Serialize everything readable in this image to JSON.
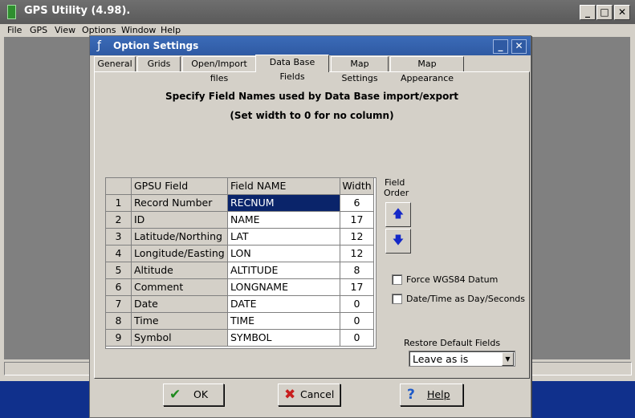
{
  "app": {
    "title": "GPS Utility (4.98).",
    "menu": [
      "File",
      "GPS",
      "View",
      "Options",
      "Window",
      "Help"
    ],
    "controls": {
      "minimize": "_",
      "maximize": "□",
      "close": "✕"
    }
  },
  "dialog": {
    "title": "Option Settings",
    "controls": {
      "minimize": "_",
      "close": "✕"
    },
    "tabs": [
      "General",
      "Grids",
      "Open/Import files",
      "Data Base Fields",
      "Map Settings",
      "Map Appearance"
    ],
    "active_tab": "Data Base Fields",
    "heading": "Specify Field Names used by Data Base import/export",
    "subheading": "(Set width to 0 for no column)",
    "table": {
      "columns": [
        "GPSU Field",
        "Field NAME",
        "Width"
      ],
      "rows": [
        {
          "num": "1",
          "gpsu": "Record Number",
          "name": "RECNUM",
          "width": "6"
        },
        {
          "num": "2",
          "gpsu": "ID",
          "name": "NAME",
          "width": "17"
        },
        {
          "num": "3",
          "gpsu": "Latitude/Northing",
          "name": "LAT",
          "width": "12"
        },
        {
          "num": "4",
          "gpsu": "Longitude/Easting",
          "name": "LON",
          "width": "12"
        },
        {
          "num": "5",
          "gpsu": "Altitude",
          "name": "ALTITUDE",
          "width": "8"
        },
        {
          "num": "6",
          "gpsu": "Comment",
          "name": "LONGNAME",
          "width": "17"
        },
        {
          "num": "7",
          "gpsu": "Date",
          "name": "DATE",
          "width": "0"
        },
        {
          "num": "8",
          "gpsu": "Time",
          "name": "TIME",
          "width": "0"
        },
        {
          "num": "9",
          "gpsu": "Symbol",
          "name": "SYMBOL",
          "width": "0"
        }
      ]
    },
    "field_order_label_1": "Field",
    "field_order_label_2": "Order",
    "checkboxes": {
      "force_wgs84": {
        "label": "Force WGS84 Datum",
        "checked": false
      },
      "datetime_day_seconds": {
        "label": "Date/Time as Day/Seconds",
        "checked": false
      }
    },
    "restore_label": "Restore Default Fields",
    "restore_value": "Leave as is",
    "buttons": {
      "ok": "OK",
      "cancel": "Cancel",
      "help": "Help"
    }
  }
}
